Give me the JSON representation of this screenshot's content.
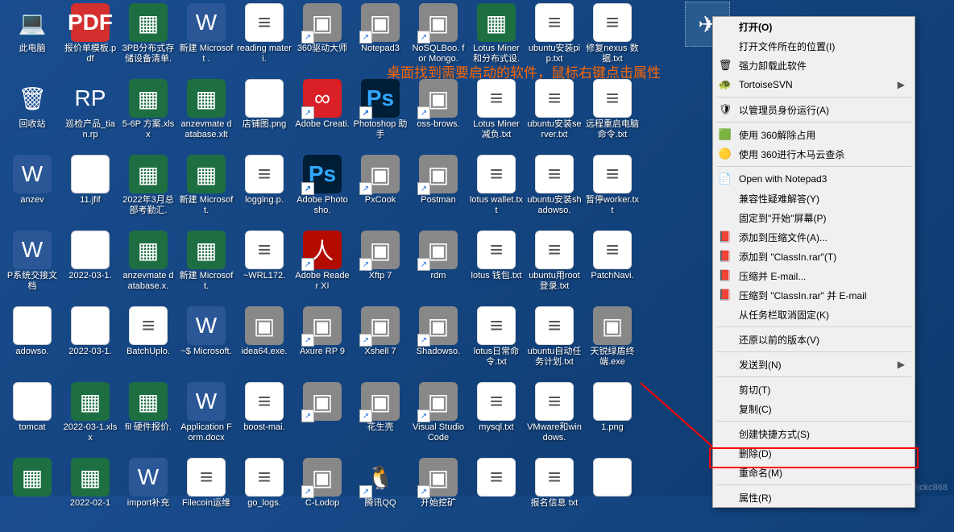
{
  "annotation": "桌面找到需要启动的软件，鼠标右键点击属性",
  "watermark": "CSDN @jckc868",
  "selected_app": "ClassIn",
  "icons": [
    {
      "l": "此电脑",
      "t": "pc"
    },
    {
      "l": "报价单模板.pdf",
      "t": "pdf"
    },
    {
      "l": "3PB分布式存储设备清单.",
      "t": "excel"
    },
    {
      "l": "新建 Microsoft .",
      "t": "word"
    },
    {
      "l": "reading materi.",
      "t": "txt"
    },
    {
      "l": "360驱动大师",
      "t": "exe",
      "link": 1
    },
    {
      "l": "Notepad3",
      "t": "exe",
      "link": 1
    },
    {
      "l": "NoSQLBoo. for Mongo.",
      "t": "exe",
      "link": 1
    },
    {
      "l": "Lotus Miner 和分布式设.",
      "t": "excel"
    },
    {
      "l": "ubuntu安装pip.txt",
      "t": "txt"
    },
    {
      "l": "修复nexus 数据.txt",
      "t": "txt"
    },
    {
      "l": "",
      "t": "blank"
    },
    {
      "l": "回收站",
      "t": "bin"
    },
    {
      "l": "巡检产品_tian.rp",
      "t": "rp"
    },
    {
      "l": "5-6P 方案.xlsx",
      "t": "excel"
    },
    {
      "l": "anzevmate database.xlt",
      "t": "excel"
    },
    {
      "l": "店铺图.png",
      "t": "png"
    },
    {
      "l": "Adobe Creati.",
      "t": "adobe-cc",
      "link": 1
    },
    {
      "l": "Photoshop 助手",
      "t": "ps",
      "link": 1
    },
    {
      "l": "oss-brows.",
      "t": "exe",
      "link": 1
    },
    {
      "l": "Lotus Miner 减负.txt",
      "t": "txt"
    },
    {
      "l": "ubuntu安装server.txt",
      "t": "txt"
    },
    {
      "l": "远程重启电脑命令.txt",
      "t": "txt"
    },
    {
      "l": "",
      "t": "blank"
    },
    {
      "l": "anzev",
      "t": "word"
    },
    {
      "l": "11.jfif",
      "t": "png"
    },
    {
      "l": "2022年3月总部考勤汇.",
      "t": "excel"
    },
    {
      "l": "新建 Microsoft.",
      "t": "excel"
    },
    {
      "l": "logging.p.",
      "t": "txt"
    },
    {
      "l": "Adobe Photosho.",
      "t": "ps",
      "link": 1
    },
    {
      "l": "PxCook",
      "t": "exe",
      "link": 1
    },
    {
      "l": "Postman",
      "t": "exe",
      "link": 1
    },
    {
      "l": "lotus wallet.txt",
      "t": "txt"
    },
    {
      "l": "ubuntu安装shadowso.",
      "t": "txt"
    },
    {
      "l": "暂停worker.txt",
      "t": "txt"
    },
    {
      "l": "",
      "t": "blank"
    },
    {
      "l": "P系统交接文档",
      "t": "word"
    },
    {
      "l": "2022-03-1.",
      "t": "png"
    },
    {
      "l": "anzevmate database.x.",
      "t": "excel"
    },
    {
      "l": "新建 Microsoft.",
      "t": "excel"
    },
    {
      "l": "~WRL172.",
      "t": "txt"
    },
    {
      "l": "Adobe Reader XI",
      "t": "pdfr",
      "link": 1
    },
    {
      "l": "Xftp 7",
      "t": "exe",
      "link": 1
    },
    {
      "l": "rdm",
      "t": "exe",
      "link": 1
    },
    {
      "l": "lotus 钱包.txt",
      "t": "txt"
    },
    {
      "l": "ubuntu用root登录.txt",
      "t": "txt"
    },
    {
      "l": "PatchNavi.",
      "t": "txt"
    },
    {
      "l": "",
      "t": "blank"
    },
    {
      "l": "adowso.",
      "t": "png"
    },
    {
      "l": "2022-03-1.",
      "t": "png"
    },
    {
      "l": "BatchUplo.",
      "t": "txt"
    },
    {
      "l": "~$ Microsoft.",
      "t": "word"
    },
    {
      "l": "idea64.exe.",
      "t": "exe"
    },
    {
      "l": "Axure RP 9",
      "t": "exe",
      "link": 1
    },
    {
      "l": "Xshell 7",
      "t": "exe",
      "link": 1
    },
    {
      "l": "Shadowso.",
      "t": "exe",
      "link": 1
    },
    {
      "l": "lotus日常命令.txt",
      "t": "txt"
    },
    {
      "l": "ubuntu自动任务计划.txt",
      "t": "txt"
    },
    {
      "l": "天锐绿盾终端.exe",
      "t": "exe"
    },
    {
      "l": "",
      "t": "blank"
    },
    {
      "l": "tomcat",
      "t": "png"
    },
    {
      "l": "2022-03-1.xlsx",
      "t": "excel"
    },
    {
      "l": "fil 硬件报价.",
      "t": "excel"
    },
    {
      "l": "Application Form.docx",
      "t": "word"
    },
    {
      "l": "boost-mai.",
      "t": "txt"
    },
    {
      "l": "",
      "t": "exe",
      "link": 1
    },
    {
      "l": "花生壳",
      "t": "exe",
      "link": 1
    },
    {
      "l": "Visual Studio Code",
      "t": "exe",
      "link": 1
    },
    {
      "l": "mysql.txt",
      "t": "txt"
    },
    {
      "l": "VMware和windows.",
      "t": "txt"
    },
    {
      "l": "1.png",
      "t": "png"
    },
    {
      "l": "",
      "t": "blank"
    },
    {
      "l": "",
      "t": "excel"
    },
    {
      "l": "2022-02-1",
      "t": "excel"
    },
    {
      "l": "import补充",
      "t": "word"
    },
    {
      "l": "Filecoin运维",
      "t": "txt"
    },
    {
      "l": "go_logs.",
      "t": "txt"
    },
    {
      "l": "C-Lodop",
      "t": "exe",
      "link": 1
    },
    {
      "l": "腾讯QQ",
      "t": "qq",
      "link": 1
    },
    {
      "l": "开始挖矿",
      "t": "exe",
      "link": 1
    },
    {
      "l": "",
      "t": "txt"
    },
    {
      "l": "报名信息 txt",
      "t": "txt"
    },
    {
      "l": "",
      "t": "png"
    },
    {
      "l": "",
      "t": "blank"
    }
  ],
  "menu": [
    {
      "label": "打开(O)",
      "bold": true
    },
    {
      "label": "打开文件所在的位置(I)"
    },
    {
      "label": "强力卸载此软件",
      "icon": "🗑"
    },
    {
      "label": "TortoiseSVN",
      "icon": "🐢",
      "sub": true
    },
    {
      "sep": true
    },
    {
      "label": "以管理员身份运行(A)",
      "icon": "🛡"
    },
    {
      "sep": true
    },
    {
      "label": "使用 360解除占用",
      "icon": "🟩"
    },
    {
      "label": "使用 360进行木马云查杀",
      "icon": "🟡"
    },
    {
      "sep": true
    },
    {
      "label": "Open with Notepad3",
      "icon": "📄"
    },
    {
      "label": "兼容性疑难解答(Y)"
    },
    {
      "label": "固定到\"开始\"屏幕(P)"
    },
    {
      "label": "添加到压缩文件(A)...",
      "icon": "📕"
    },
    {
      "label": "添加到 \"ClassIn.rar\"(T)",
      "icon": "📕"
    },
    {
      "label": "压缩并 E-mail...",
      "icon": "📕"
    },
    {
      "label": "压缩到 \"ClassIn.rar\" 并 E-mail",
      "icon": "📕"
    },
    {
      "label": "从任务栏取消固定(K)"
    },
    {
      "sep": true
    },
    {
      "label": "还原以前的版本(V)"
    },
    {
      "sep": true
    },
    {
      "label": "发送到(N)",
      "sub": true
    },
    {
      "sep": true
    },
    {
      "label": "剪切(T)"
    },
    {
      "label": "复制(C)"
    },
    {
      "sep": true
    },
    {
      "label": "创建快捷方式(S)"
    },
    {
      "label": "删除(D)"
    },
    {
      "label": "重命名(M)"
    },
    {
      "sep": true
    },
    {
      "label": "属性(R)"
    }
  ]
}
